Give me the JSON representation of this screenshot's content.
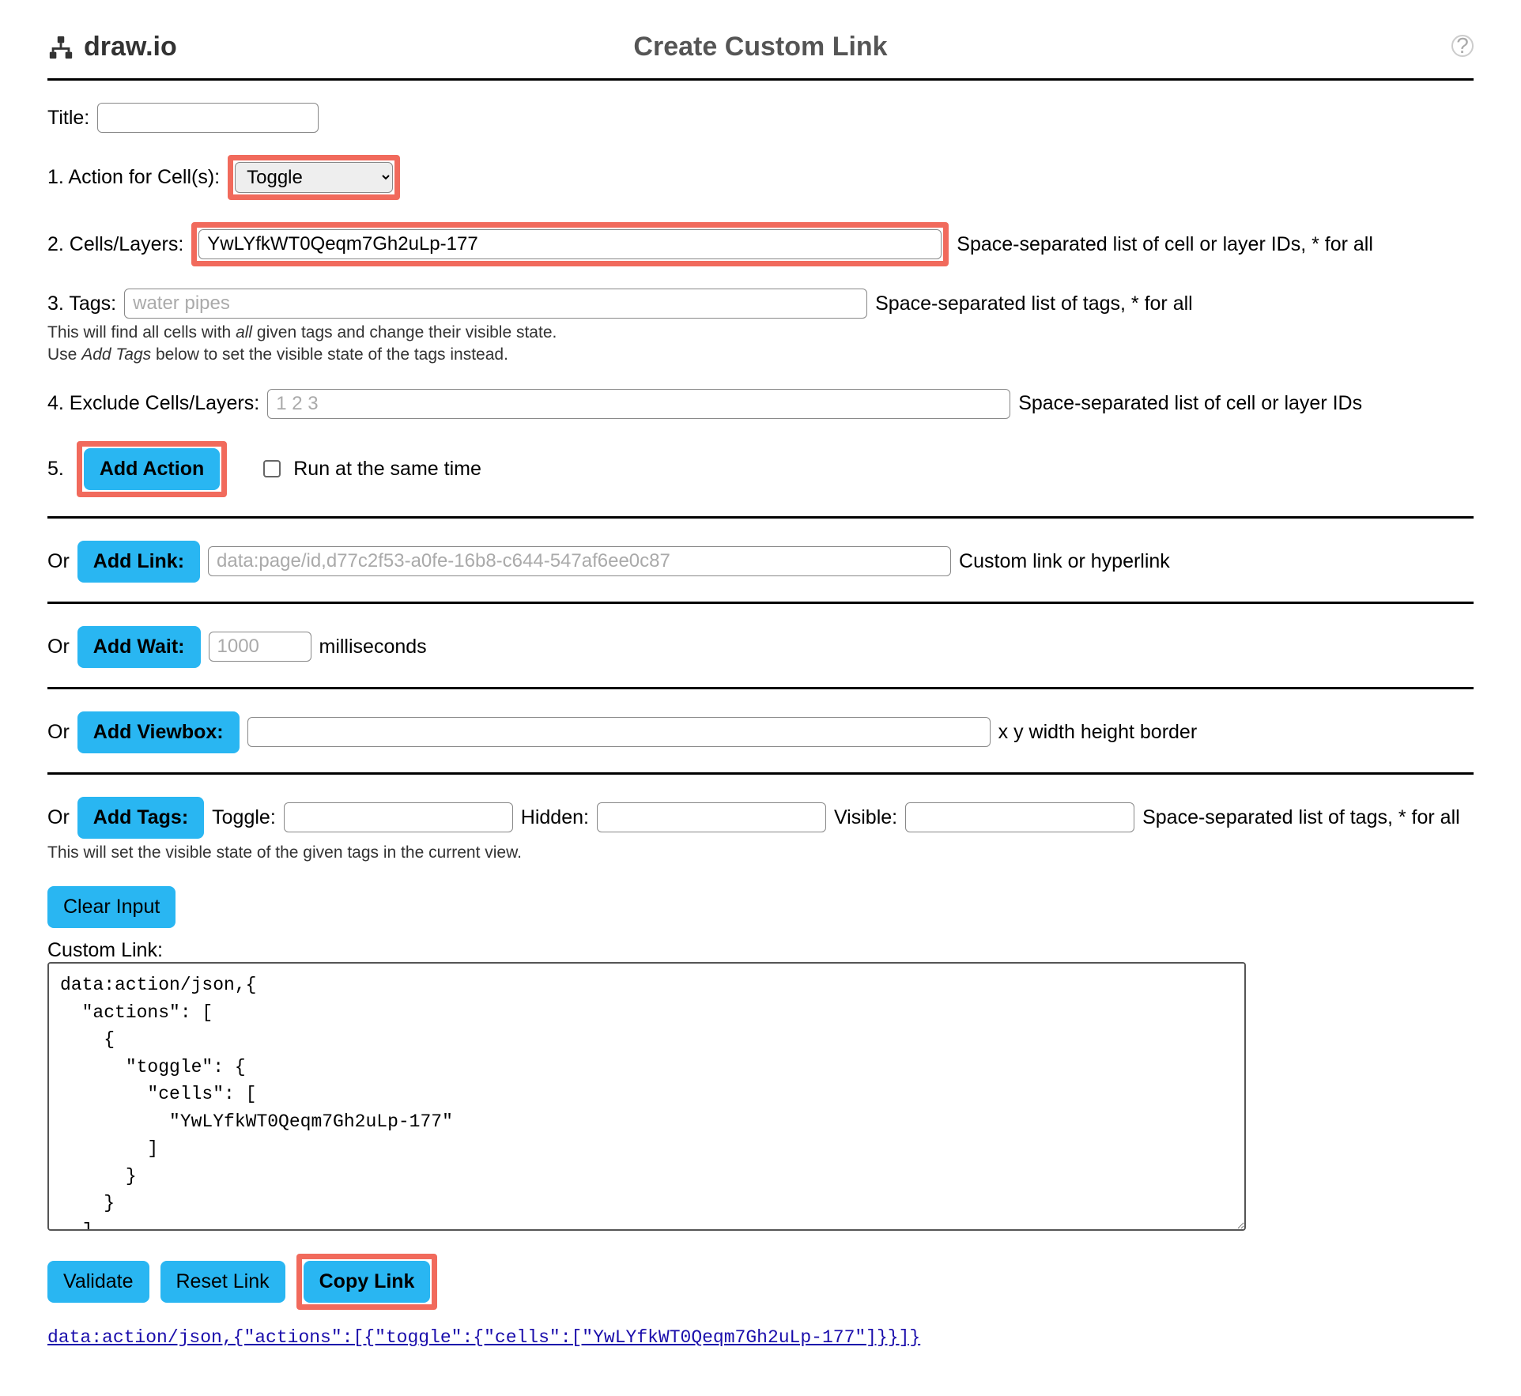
{
  "header": {
    "brand": "draw.io",
    "title": "Create Custom Link",
    "help_tooltip": "?"
  },
  "title_row": {
    "label": "Title:",
    "value": ""
  },
  "step1": {
    "label": "1. Action for Cell(s):",
    "selected": "Toggle"
  },
  "step2": {
    "label": "2. Cells/Layers:",
    "value": "YwLYfkWT0Qeqm7Gh2uLp-177",
    "hint": "Space-separated list of cell or layer IDs, * for all"
  },
  "step3": {
    "label": "3. Tags:",
    "placeholder": "water pipes",
    "hint_right": "Space-separated list of tags, * for all",
    "hint_below_1a": "This will find all cells with ",
    "hint_below_1b": "all",
    "hint_below_1c": " given tags and change their visible state.",
    "hint_below_2a": "Use ",
    "hint_below_2b": "Add Tags",
    "hint_below_2c": " below to set the visible state of the tags instead."
  },
  "step4": {
    "label": "4. Exclude Cells/Layers:",
    "placeholder": "1 2 3",
    "hint": "Space-separated list of cell or layer IDs"
  },
  "step5": {
    "label": "5.",
    "button": "Add Action",
    "checkbox_label": "Run at the same time"
  },
  "or_addlink": {
    "or": "Or",
    "button": "Add Link:",
    "placeholder": "data:page/id,d77c2f53-a0fe-16b8-c644-547af6ee0c87",
    "hint": "Custom link or hyperlink"
  },
  "or_addwait": {
    "or": "Or",
    "button": "Add Wait:",
    "placeholder": "1000",
    "unit": "milliseconds"
  },
  "or_addviewbox": {
    "or": "Or",
    "button": "Add Viewbox:",
    "hint": "x y width height border"
  },
  "or_addtags": {
    "or": "Or",
    "button": "Add Tags:",
    "toggle_label": "Toggle:",
    "hidden_label": "Hidden:",
    "visible_label": "Visible:",
    "hint_right": "Space-separated list of tags, * for all",
    "hint_below": "This will set the visible state of the given tags in the current view."
  },
  "clear_input": "Clear Input",
  "custom_link_label": "Custom Link:",
  "custom_link_value": "data:action/json,{\n  \"actions\": [\n    {\n      \"toggle\": {\n        \"cells\": [\n          \"YwLYfkWT0Qeqm7Gh2uLp-177\"\n        ]\n      }\n    }\n  ]\n}",
  "bottom": {
    "validate": "Validate",
    "reset": "Reset Link",
    "copy": "Copy Link"
  },
  "result_link": "data:action/json,{\"actions\":[{\"toggle\":{\"cells\":[\"YwLYfkWT0Qeqm7Gh2uLp-177\"]}}]}"
}
